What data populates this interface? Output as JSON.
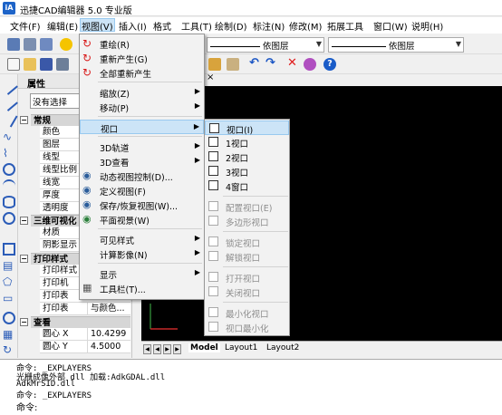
{
  "window": {
    "title": "迅捷CAD编辑器 5.0 专业版",
    "icon_text": "iA"
  },
  "menubar": [
    {
      "label": "文件(F)"
    },
    {
      "label": "编辑(E)"
    },
    {
      "label": "视图(V)"
    },
    {
      "label": "插入(I)"
    },
    {
      "label": "格式"
    },
    {
      "label": "工具(T)"
    },
    {
      "label": "绘制(D)"
    },
    {
      "label": "标注(N)"
    },
    {
      "label": "修改(M)"
    },
    {
      "label": "拓展工具"
    },
    {
      "label": "窗口(W)"
    },
    {
      "label": "说明(H)"
    }
  ],
  "toolbar": {
    "layer_combo": "依图层",
    "linetype_combo": "依图层"
  },
  "properties": {
    "title": "属性",
    "selection": "没有选择",
    "categories": {
      "general": "常规",
      "view3d": "三维可视化",
      "print": "打印样式",
      "view": "查看"
    },
    "general_rows": [
      "颜色",
      "图层",
      "线型",
      "线型比例",
      "线宽",
      "厚度",
      "透明度"
    ],
    "view3d_rows": [
      "材质",
      "阴影显示"
    ],
    "print_rows": [
      {
        "name": "打印样式",
        "value": ""
      },
      {
        "name": "打印机",
        "value": ""
      },
      {
        "name": "打印表",
        "value": ""
      },
      {
        "name": "打印表",
        "value": "与颜色..."
      }
    ],
    "view_rows": [
      {
        "name": "圆心 X",
        "value": "10.4299"
      },
      {
        "name": "圆心 Y",
        "value": "4.5000"
      }
    ]
  },
  "view_menu": {
    "items": [
      {
        "label": "重绘(R)",
        "sub": ""
      },
      {
        "label": "重新产生(G)",
        "sub": ""
      },
      {
        "label": "全部重新产生",
        "sub": ""
      },
      {
        "label": "缩放(Z)",
        "sub": "▶"
      },
      {
        "label": "移动(P)",
        "sub": "▶"
      },
      {
        "label": "视口",
        "sub": "▶"
      },
      {
        "label": "3D轨道",
        "sub": "▶"
      },
      {
        "label": "3D查看",
        "sub": "▶"
      },
      {
        "label": "动态视图控制(D)...",
        "sub": ""
      },
      {
        "label": "定义视图(F)",
        "sub": ""
      },
      {
        "label": "保存/恢复视图(W)...",
        "sub": ""
      },
      {
        "label": "平面视景(W)",
        "sub": ""
      },
      {
        "label": "可见样式",
        "sub": "▶"
      },
      {
        "label": "计算影像(N)",
        "sub": "▶"
      },
      {
        "label": "显示",
        "sub": "▶"
      },
      {
        "label": "工具栏(T)...",
        "sub": ""
      }
    ]
  },
  "viewport_submenu": {
    "items": [
      {
        "label": "视口(I)"
      },
      {
        "label": "1视口"
      },
      {
        "label": "2视口"
      },
      {
        "label": "3视口"
      },
      {
        "label": "4窗口"
      },
      {
        "label": "配置视口(E)"
      },
      {
        "label": "多边形视口"
      },
      {
        "label": "锁定视口"
      },
      {
        "label": "解锁视口"
      },
      {
        "label": "打开视口"
      },
      {
        "label": "关闭视口"
      },
      {
        "label": "最小化视口"
      },
      {
        "label": "视口最小化"
      }
    ]
  },
  "layout_tabs": [
    "Model",
    "Layout1",
    "Layout2"
  ],
  "command": {
    "lines": [
      "命令: _EXPLAYERS",
      "光栅成像外部 dll 加载:AdkGDAL.dll",
      "AdkMrSID.dll",
      "命令: _EXPLAYERS"
    ],
    "prompt": "命令:"
  }
}
